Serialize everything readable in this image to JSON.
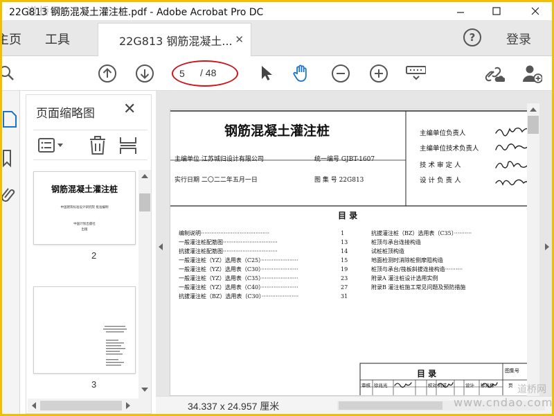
{
  "window": {
    "title": "22G813 钢筋混凝土灌注桩.pdf - Adobe Acrobat Pro DC",
    "watermark_top": "道桥网"
  },
  "tabs": {
    "home": "主页",
    "tools": "工具",
    "document": "22G813 钢筋混凝土...",
    "help": "?",
    "login": "登录"
  },
  "toolbar": {
    "page_current": "5",
    "page_total": "/ 48"
  },
  "thumbnails": {
    "title": "页面缩略图",
    "pages": [
      {
        "number": "2",
        "title": "钢筋混凝土灌注桩",
        "subtitle": "中国建筑标准设计研究院 批准编制",
        "line2": "中国计划出版社",
        "line3": "出版"
      },
      {
        "number": "3"
      }
    ]
  },
  "document": {
    "title": "钢筋混凝土灌注桩",
    "org_label": "主编单位 江苏城归设计有限公司",
    "code_label": "统一编号 GJBT-1607",
    "date_label": "实行日期 二〇二二年五月一日",
    "atlas_label": "图 集 号 22G813",
    "signoff": [
      "主编单位负责人",
      "主编单位技术负责人",
      "技 术 审 定 人",
      "设 计 负 责 人"
    ],
    "toc_heading": "目  录",
    "toc_left": [
      {
        "name": "编制说明·······································",
        "page": "1"
      },
      {
        "name": "一般灌注桩配筋图·······························",
        "page": "13"
      },
      {
        "name": "抗拔灌注桩配筋图·······························",
        "page": "14"
      },
      {
        "name": "一般灌注桩（YZ）选用表（C25）·····················",
        "page": "15"
      },
      {
        "name": "一般灌注桩（YZ）选用表（C30）·····················",
        "page": "19"
      },
      {
        "name": "一般灌注桩（YZ）选用表（C35）·····················",
        "page": "23"
      },
      {
        "name": "一般灌注桩（YZ）选用表（C40）·····················",
        "page": "27"
      },
      {
        "name": "抗拔灌注桩（BZ）选用表（C30）·····················",
        "page": "31"
      }
    ],
    "toc_right": [
      "抗拔灌注桩（BZ）选用表（C35）··········",
      "桩顶与承台连接构造",
      "试桩桩顶构造",
      "地面检测时消除桩侧摩阻构造",
      "桩顶与承台/筏板斜拔连接构造··········",
      "附录A 灌注桩设计选用实例",
      "附录B 灌注桩施工常见问题及预防措施"
    ],
    "titleblock_heading": "目  录",
    "titleblock_right_label": "图集号",
    "titleblock_row": [
      "审核",
      "徐兆光",
      "",
      "校对",
      "刘成",
      "",
      "设计",
      "徐兆栋",
      "",
      "页"
    ]
  },
  "status": {
    "dimensions": "34.337 x 24.957 厘米",
    "watermark": "www.cndao.com",
    "watermark_corner": "道桥网"
  },
  "colors": {
    "accent": "#1a73c8",
    "annotation": "#d0121a"
  }
}
